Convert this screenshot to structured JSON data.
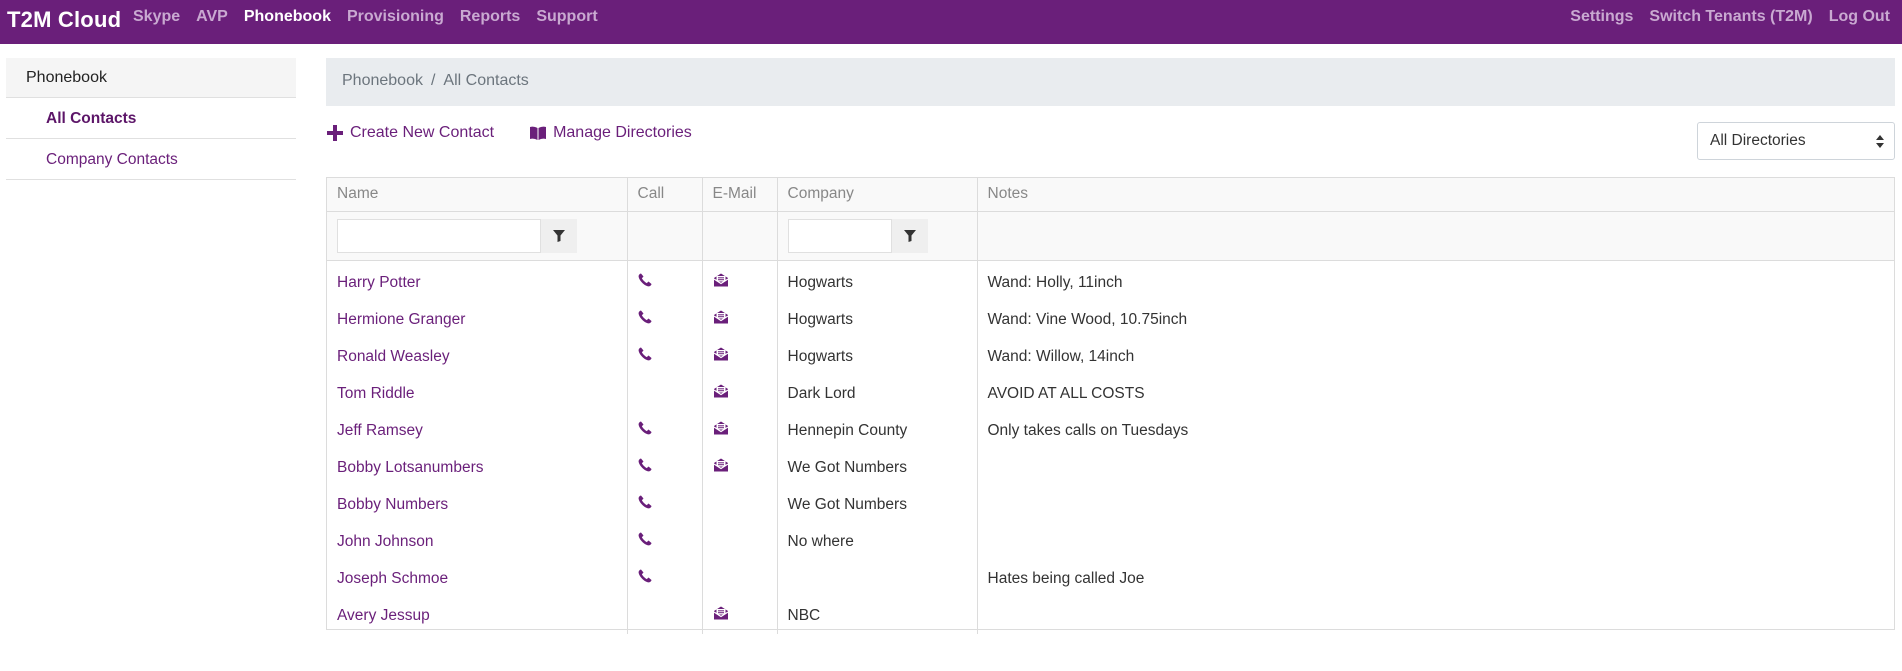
{
  "navbar": {
    "brand": "T2M Cloud",
    "left_links": [
      "Skype",
      "AVP",
      "Phonebook",
      "Provisioning",
      "Reports",
      "Support"
    ],
    "active": "Phonebook",
    "right_links": [
      "Settings",
      "Switch Tenants (T2M)",
      "Log Out"
    ],
    "bg_color": "#6a1f7a"
  },
  "sidebar": {
    "header": "Phonebook",
    "items": [
      {
        "label": "All Contacts",
        "active": true
      },
      {
        "label": "Company Contacts",
        "active": false
      }
    ]
  },
  "breadcrumb": {
    "root": "Phonebook",
    "separator": "/",
    "current": "All Contacts"
  },
  "actions": {
    "create_label": "Create New Contact",
    "create_icon": "plus-icon",
    "manage_label": "Manage Directories",
    "manage_icon": "book-icon"
  },
  "directory_select": {
    "value": "All Directories"
  },
  "table": {
    "columns": [
      "Name",
      "Call",
      "E-Mail",
      "Company",
      "Notes"
    ],
    "filters": {
      "name": {
        "value": "",
        "icon": "filter-icon"
      },
      "company": {
        "value": "",
        "icon": "filter-icon"
      }
    },
    "rows": [
      {
        "name": "Harry Potter",
        "call": true,
        "email": true,
        "company": "Hogwarts",
        "notes": "Wand: Holly, 11inch"
      },
      {
        "name": "Hermione Granger",
        "call": true,
        "email": true,
        "company": "Hogwarts",
        "notes": "Wand: Vine Wood, 10.75inch"
      },
      {
        "name": "Ronald Weasley",
        "call": true,
        "email": true,
        "company": "Hogwarts",
        "notes": "Wand: Willow, 14inch"
      },
      {
        "name": "Tom Riddle",
        "call": false,
        "email": true,
        "company": "Dark Lord",
        "notes": "AVOID AT ALL COSTS"
      },
      {
        "name": "Jeff Ramsey",
        "call": true,
        "email": true,
        "company": "Hennepin County",
        "notes": "Only takes calls on Tuesdays"
      },
      {
        "name": "Bobby Lotsanumbers",
        "call": true,
        "email": true,
        "company": "We Got Numbers",
        "notes": ""
      },
      {
        "name": "Bobby Numbers",
        "call": true,
        "email": false,
        "company": "We Got Numbers",
        "notes": ""
      },
      {
        "name": "John Johnson",
        "call": true,
        "email": false,
        "company": "No where",
        "notes": ""
      },
      {
        "name": "Joseph Schmoe",
        "call": true,
        "email": false,
        "company": "",
        "notes": "Hates being called Joe"
      },
      {
        "name": "Avery Jessup",
        "call": false,
        "email": true,
        "company": "NBC",
        "notes": ""
      }
    ]
  }
}
